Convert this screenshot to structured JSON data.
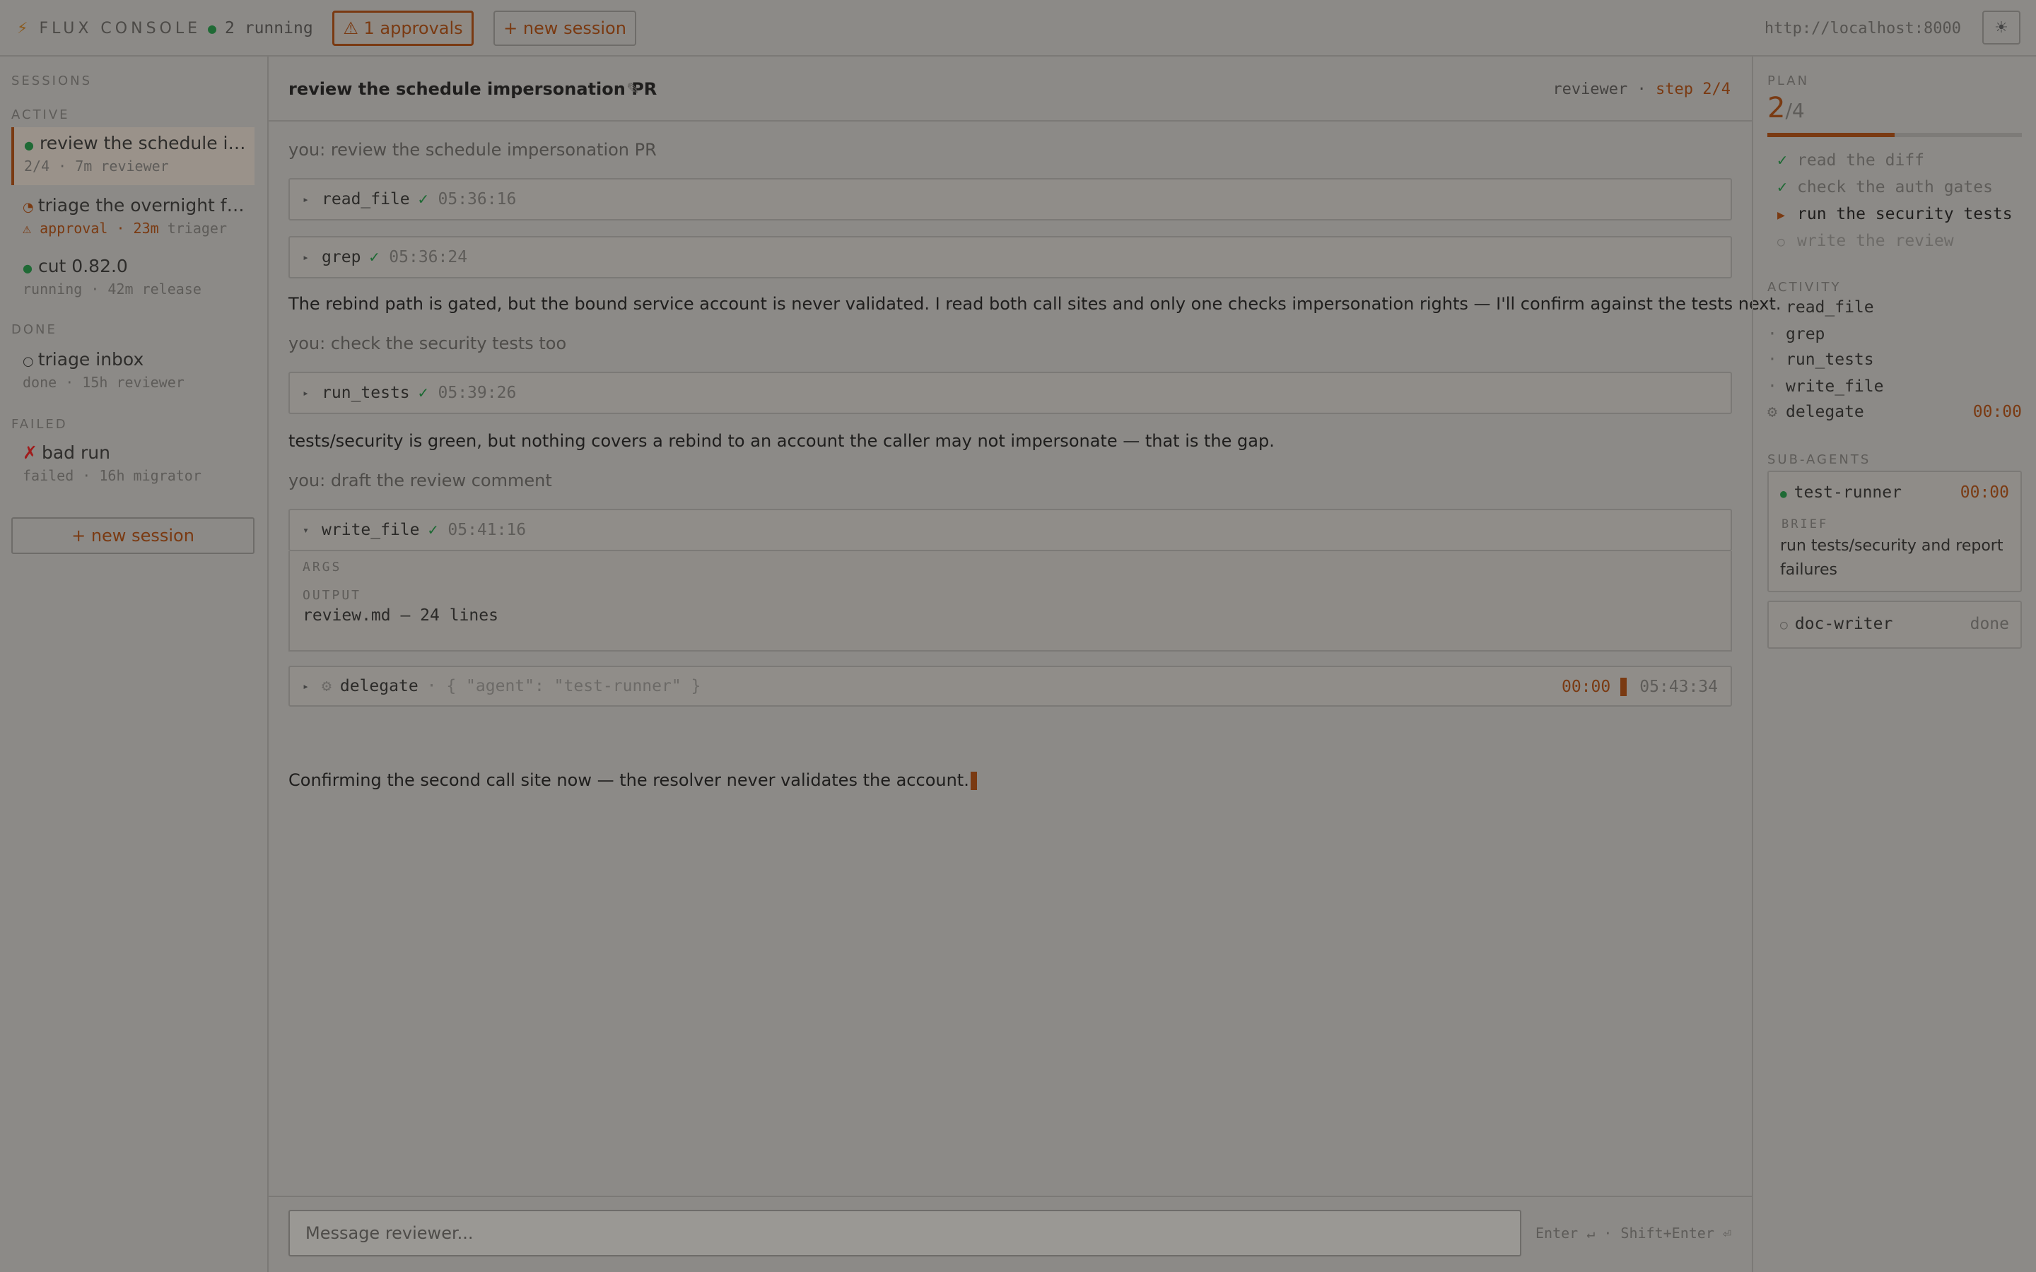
{
  "topbar": {
    "brand_icon": "⚡",
    "brand": "FLUX CONSOLE",
    "running": "2 running",
    "approvals": "⚠ 1 approvals",
    "new_session": "+ new session",
    "url": "http://localhost:8000",
    "theme_icon": "☀"
  },
  "sidebar": {
    "sessions_heading": "SESSIONS",
    "active_heading": "ACTIVE",
    "done_heading": "DONE",
    "failed_heading": "FAILED",
    "active": [
      {
        "icon": "●",
        "title": "review the schedule impersonation PR",
        "meta_a": "2/4 · 7m",
        "meta_b": "reviewer"
      },
      {
        "icon": "◔",
        "title": "triage the overnight failures",
        "meta_a": "⚠ approval · 23m",
        "meta_b": "triager"
      },
      {
        "icon": "●",
        "title": "cut 0.82.0",
        "meta_a": "running · 42m",
        "meta_b": "release"
      }
    ],
    "done": [
      {
        "icon": "○",
        "title": "triage inbox",
        "meta_a": "done · 15h",
        "meta_b": "reviewer"
      }
    ],
    "failed": [
      {
        "icon": "✗",
        "title": "bad run",
        "meta_a": "failed · 16h",
        "meta_b": "migrator"
      }
    ],
    "new_session": "+ new session"
  },
  "main": {
    "title": "review the schedule impersonation PR",
    "edit_icon": "✎",
    "agent": "reviewer ·",
    "step": "step 2/4",
    "user1": "you: review the schedule impersonation PR",
    "tool1": {
      "caret": "▸",
      "name": "read_file",
      "check": "✓",
      "time": "05:36:16"
    },
    "tool2": {
      "caret": "▸",
      "name": "grep",
      "check": "✓",
      "time": "05:36:24"
    },
    "assist1": "The rebind path is gated, but the bound service account is never validated. I read both call sites and only one checks impersonation rights — I'll confirm against the tests next.",
    "user2": "you: check the security tests too",
    "tool3": {
      "caret": "▸",
      "name": "run_tests",
      "check": "✓",
      "time": "05:39:26"
    },
    "assist2": "tests/security is green, but nothing covers a rebind to an account the caller may not impersonate — that is the gap.",
    "user3": "you: draft the review comment",
    "tool4": {
      "caret": "▾",
      "name": "write_file",
      "check": "✓",
      "time": "05:41:16",
      "args_label": "ARGS",
      "output_label": "OUTPUT",
      "output": "review.md — 24 lines"
    },
    "tool5": {
      "caret": "▸",
      "icon": "⚙",
      "name": "delegate",
      "args": "· { \"agent\": \"test-runner\" }",
      "timer": "00:00",
      "time": "05:43:34"
    },
    "assist3": "Confirming the second call site now — the resolver never validates the account.",
    "composer_placeholder": "Message reviewer...",
    "hint": "Enter ↵ · Shift+Enter ⏎"
  },
  "plan": {
    "heading": "PLAN",
    "current": "2",
    "total": "/4",
    "progress": 0.5,
    "steps": [
      {
        "mark": "✓",
        "label": "read the diff"
      },
      {
        "mark": "✓",
        "label": "check the auth gates"
      },
      {
        "mark": "▶",
        "label": "run the security tests"
      },
      {
        "mark": "○",
        "label": "write the review"
      }
    ]
  },
  "activity": {
    "heading": "ACTIVITY",
    "items": [
      {
        "mark": "·",
        "label": "read_file"
      },
      {
        "mark": "·",
        "label": "grep"
      },
      {
        "mark": "·",
        "label": "run_tests"
      },
      {
        "mark": "·",
        "label": "write_file"
      },
      {
        "mark": "⚙",
        "label": "delegate",
        "timer": "00:00"
      }
    ]
  },
  "subagents": {
    "heading": "SUB-AGENTS",
    "items": [
      {
        "icon": "●",
        "name": "test-runner",
        "timer": "00:00",
        "brief_label": "BRIEF",
        "brief": "run tests/security and report failures"
      },
      {
        "icon": "○",
        "name": "doc-writer",
        "status": "done"
      }
    ]
  },
  "colors": {
    "accent": "#7a3a12",
    "running_green": "#1f6a35",
    "failed_red": "#a01c1c",
    "background": "#8c8a87"
  }
}
